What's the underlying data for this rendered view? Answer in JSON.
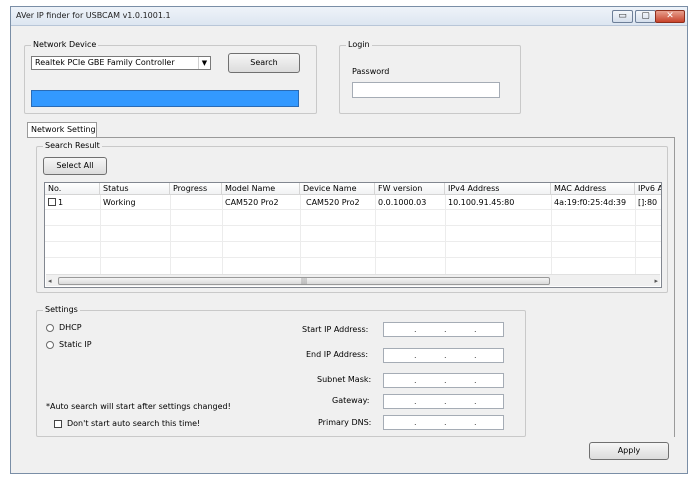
{
  "window": {
    "title": "AVer IP finder for USBCAM v1.0.1001.1",
    "minimize": "▭",
    "maximize": "▢",
    "close": "✕"
  },
  "network_device": {
    "legend": "Network Device",
    "adapter_value": "Realtek PCIe GBE Family Controller",
    "search_label": "Search",
    "progress_fraction": 1.0,
    "progress_color": "#3399ff"
  },
  "login": {
    "legend": "Login",
    "password_label": "Password",
    "password_value": ""
  },
  "tabs": [
    {
      "label": "Network Setting"
    }
  ],
  "search_result": {
    "legend": "Search Result",
    "select_all_label": "Select All",
    "columns": [
      "No.",
      "Status",
      "Progress",
      "Model Name",
      "Device Name",
      "FW version",
      "IPv4 Address",
      "MAC Address",
      "IPv6 A"
    ],
    "rows": [
      {
        "no": "1",
        "status": "Working",
        "progress": "",
        "model": "CAM520 Pro2",
        "device": "CAM520 Pro2",
        "fw": "0.0.1000.03",
        "ipv4": "10.100.91.45:80",
        "mac": "4a:19:f0:25:4d:39",
        "ipv6": "[]:80"
      }
    ],
    "scroll_grip": "|||"
  },
  "settings": {
    "legend": "Settings",
    "dhcp_label": "DHCP",
    "static_ip_label": "Static IP",
    "auto_search_note": "*Auto search will start after settings changed!",
    "dont_start_label": "Don't start auto search this time!",
    "start_ip_label": "Start IP Address:",
    "end_ip_label": "End IP Address:",
    "subnet_label": "Subnet Mask:",
    "gateway_label": "Gateway:",
    "dns_label": "Primary DNS:",
    "ip_dot": "."
  },
  "apply_label": "Apply"
}
